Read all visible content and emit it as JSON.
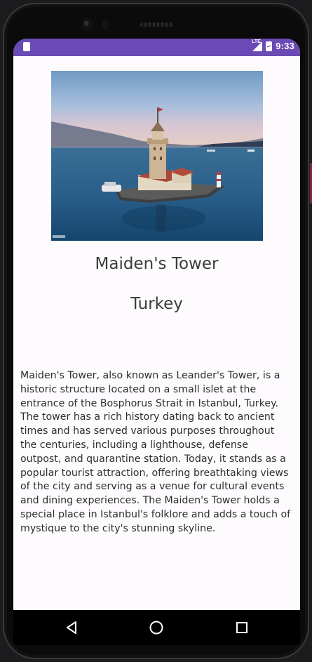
{
  "status_bar": {
    "network_label": "LTE",
    "time": "9:33"
  },
  "article": {
    "image_alt": "Maiden's Tower on a small islet in the Bosphorus",
    "title": "Maiden's Tower",
    "country": "Turkey",
    "description": "Maiden's Tower, also known as Leander's Tower, is a historic structure located on a small islet at the entrance of the Bosphorus Strait in Istanbul, Turkey. The tower has a rich history dating back to ancient times and has served various purposes throughout the centuries, including a lighthouse, defense outpost, and quarantine station. Today, it stands as a popular tourist attraction, offering breathtaking views of the city and serving as a venue for cultural events and dining experiences. The Maiden's Tower holds a special place in Istanbul's folklore and adds a touch of mystique to the city's stunning skyline."
  },
  "navigation": {
    "back_icon": "back-triangle-icon",
    "home_icon": "home-circle-icon",
    "recents_icon": "recents-square-icon"
  },
  "colors": {
    "status_bar": "#6a4ab5",
    "screen_background": "#fdfbfe",
    "text": "#3c3c3c",
    "nav_bar": "#000000"
  }
}
